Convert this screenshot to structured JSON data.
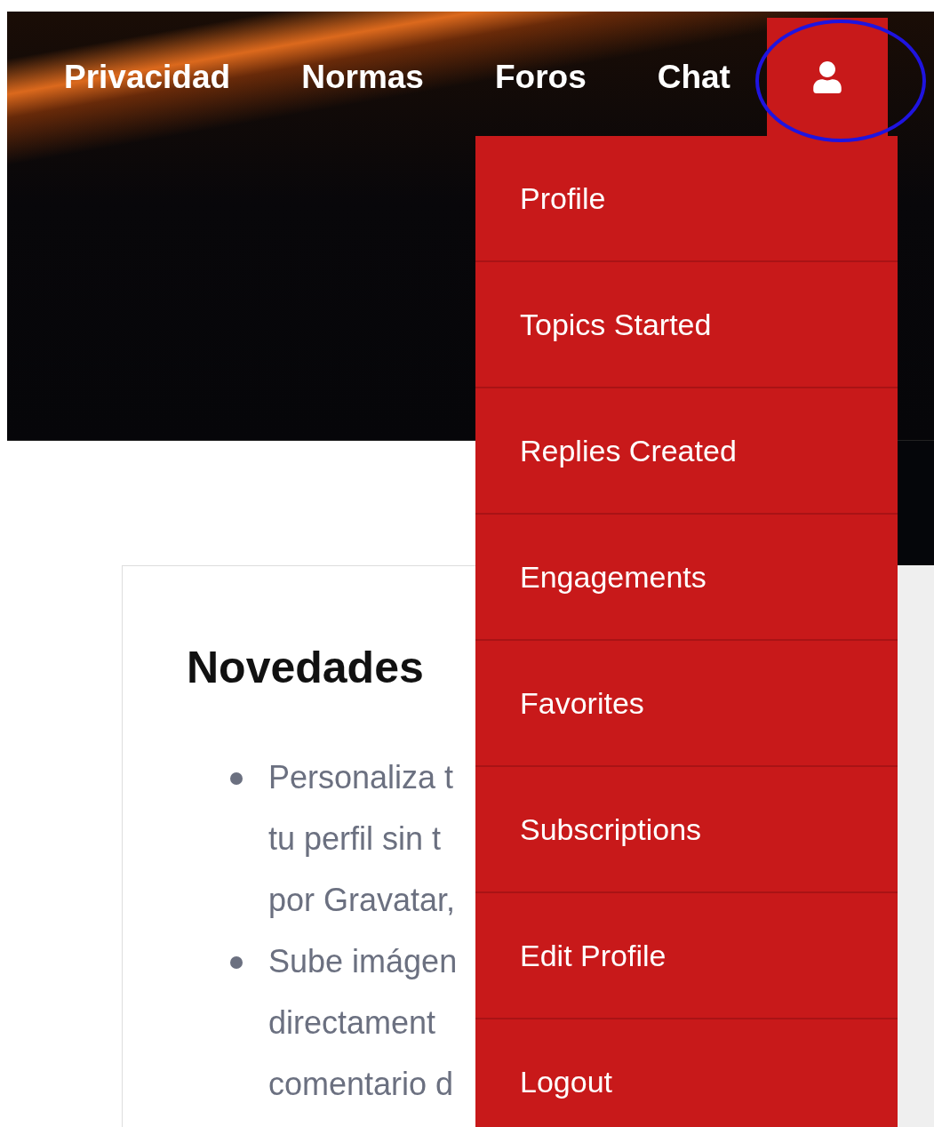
{
  "nav": {
    "links": [
      "Privacidad",
      "Normas",
      "Foros",
      "Chat"
    ]
  },
  "user_menu": {
    "expanded": true,
    "items": [
      "Profile",
      "Topics Started",
      "Replies Created",
      "Engagements",
      "Favorites",
      "Subscriptions",
      "Edit Profile",
      "Logout"
    ]
  },
  "annotation_circle": true,
  "content": {
    "title": "Novedades",
    "bullets": [
      {
        "lines": [
          "Personaliza t",
          "tu perfil sin t",
          "por Gravatar,"
        ]
      },
      {
        "lines": [
          "Sube imágen",
          "directament",
          "comentario d"
        ]
      }
    ]
  }
}
